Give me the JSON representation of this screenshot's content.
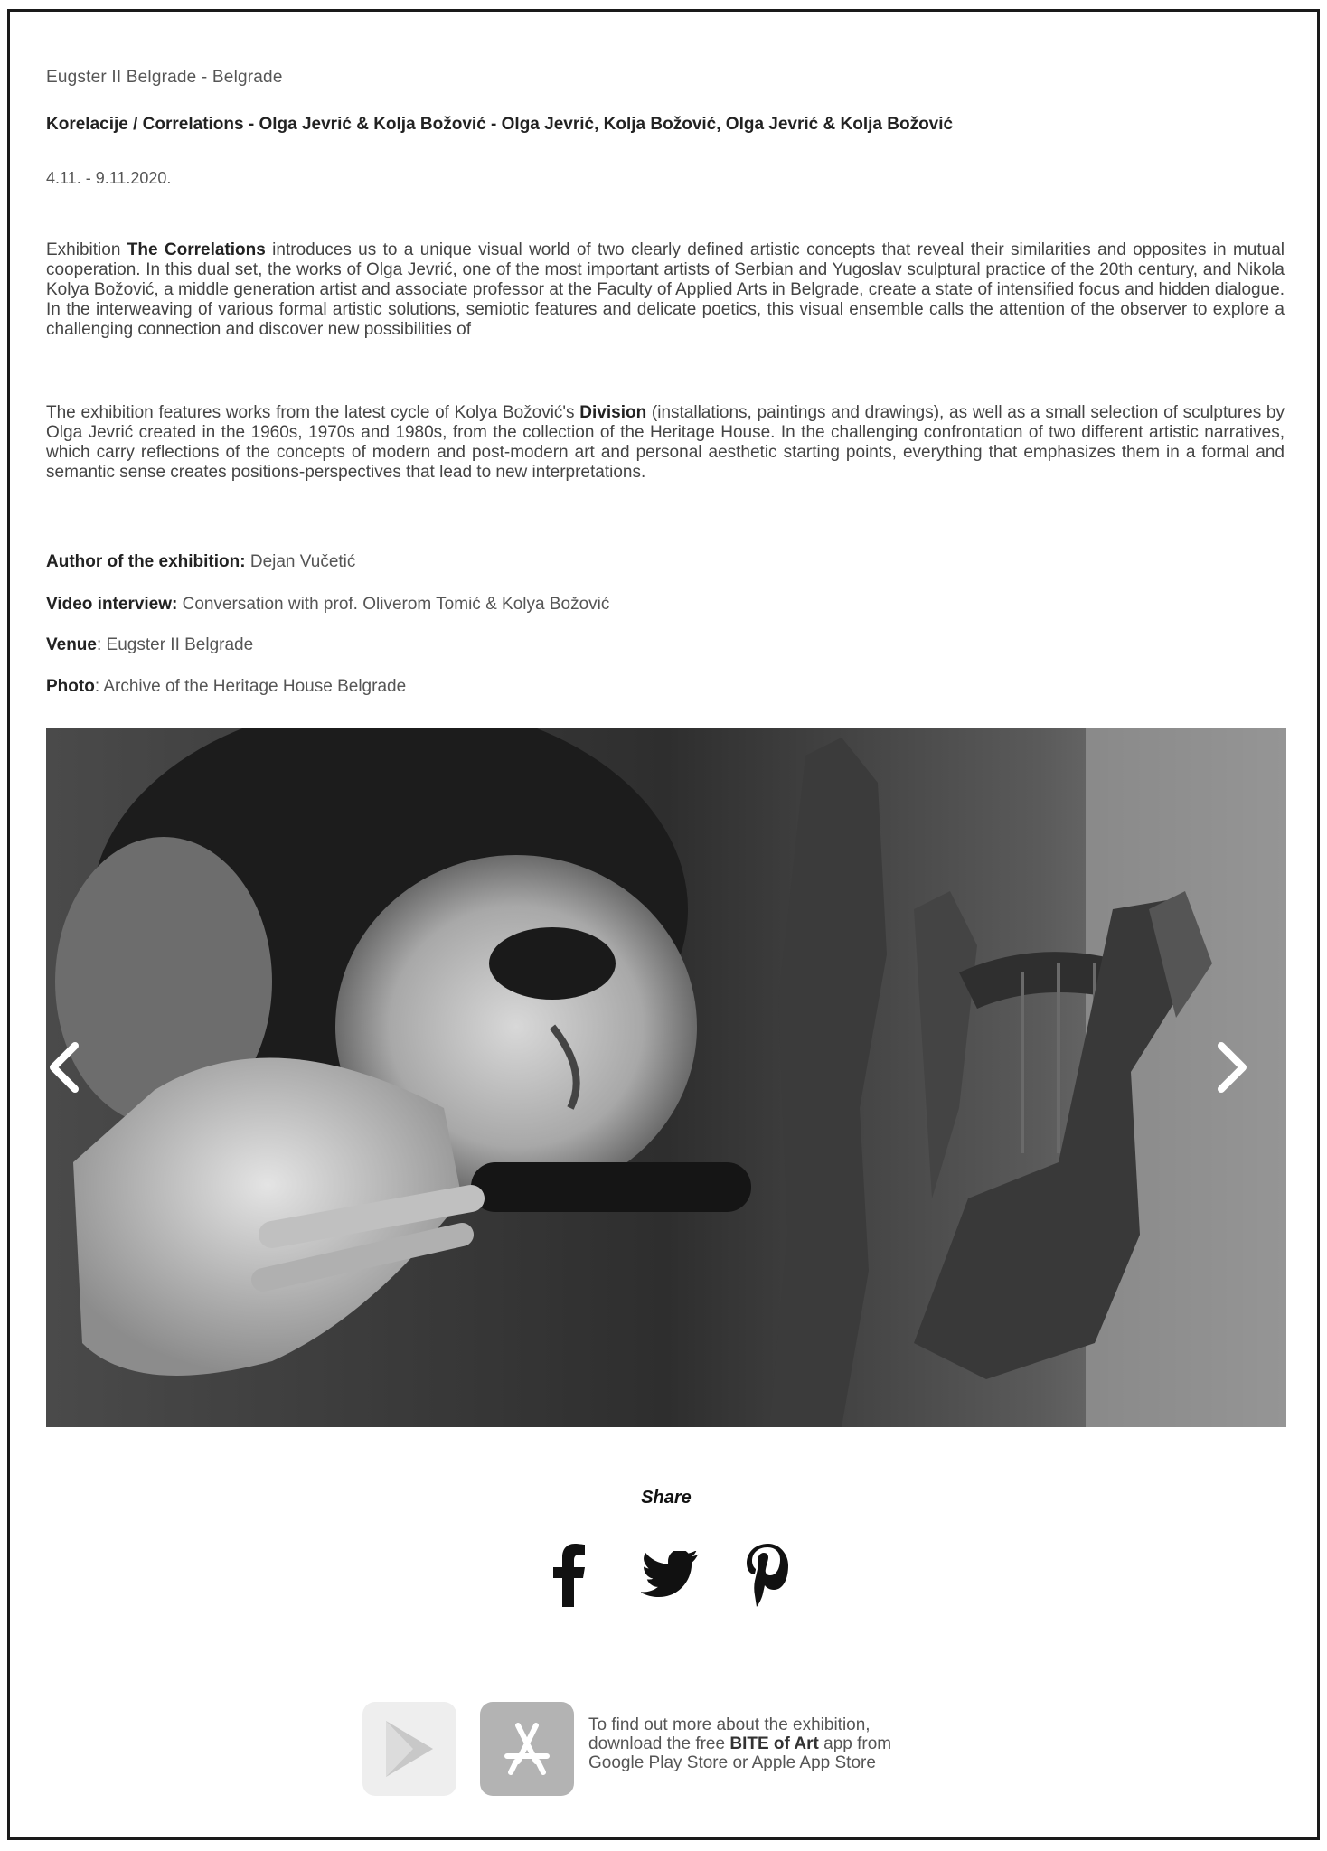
{
  "venue_line": "Eugster II Belgrade - Belgrade",
  "title_line": "Korelacije / Correlations - Olga Jevrić & Kolja Božović - Olga Jevrić, Kolja Božović, Olga Jevrić & Kolja Božović",
  "date_line": "4.11. - 9.11.2020.",
  "paragraph1": {
    "pre": "Exhibition ",
    "bold": "The Correlations",
    "post": " introduces us to a unique visual world of two clearly defined artistic concepts that reveal their similarities and opposites in mutual cooperation. In this dual set, the works of Olga Jevrić, one of the most important artists of Serbian and Yugoslav sculptural practice of the 20th century, and Nikola Kolya Božović, a middle generation artist and associate professor at the Faculty of Applied Arts in Belgrade, create a state of intensified focus and hidden dialogue. In the interweaving of various formal artistic solutions, semiotic features and delicate poetics, this visual ensemble calls the attention of the observer to explore a challenging connection and discover new possibilities of"
  },
  "paragraph2": {
    "pre": "The exhibition features works from the latest cycle of Kolya Božović's ",
    "bold": "Division",
    "post": " (installations, paintings and drawings), as well as a small selection of sculptures by Olga Jevrić created in the 1960s, 1970s and 1980s, from the collection of the Heritage House. In the challenging confrontation of two different artistic narratives, which carry reflections of the concepts of modern and post-modern art and personal aesthetic starting points, everything that emphasizes them in a formal and semantic sense creates positions-perspectives that lead to new interpretations."
  },
  "meta": {
    "author_label": "Author of the exhibition:",
    "author_value": " Dejan Vučetić",
    "video_label": "Video interview:",
    "video_value": " Conversation with prof. Oliverom Tomić & Kolya Božović",
    "venue_label": "Venue",
    "venue_value": ": Eugster II Belgrade",
    "photo_label": "Photo",
    "photo_value": ": Archive of the Heritage House Belgrade"
  },
  "slider": {
    "prev_icon": "chevron-left-icon",
    "next_icon": "chevron-right-icon"
  },
  "share": {
    "label": "Share",
    "icons": [
      "facebook-icon",
      "twitter-icon",
      "pinterest-icon"
    ]
  },
  "app_promo": {
    "line1": "To find out more about the exhibition,",
    "line2_pre": "download the free ",
    "line2_bold": "BITE of Art",
    "line2_post": " app from",
    "line3": "Google Play Store or Apple App Store"
  }
}
